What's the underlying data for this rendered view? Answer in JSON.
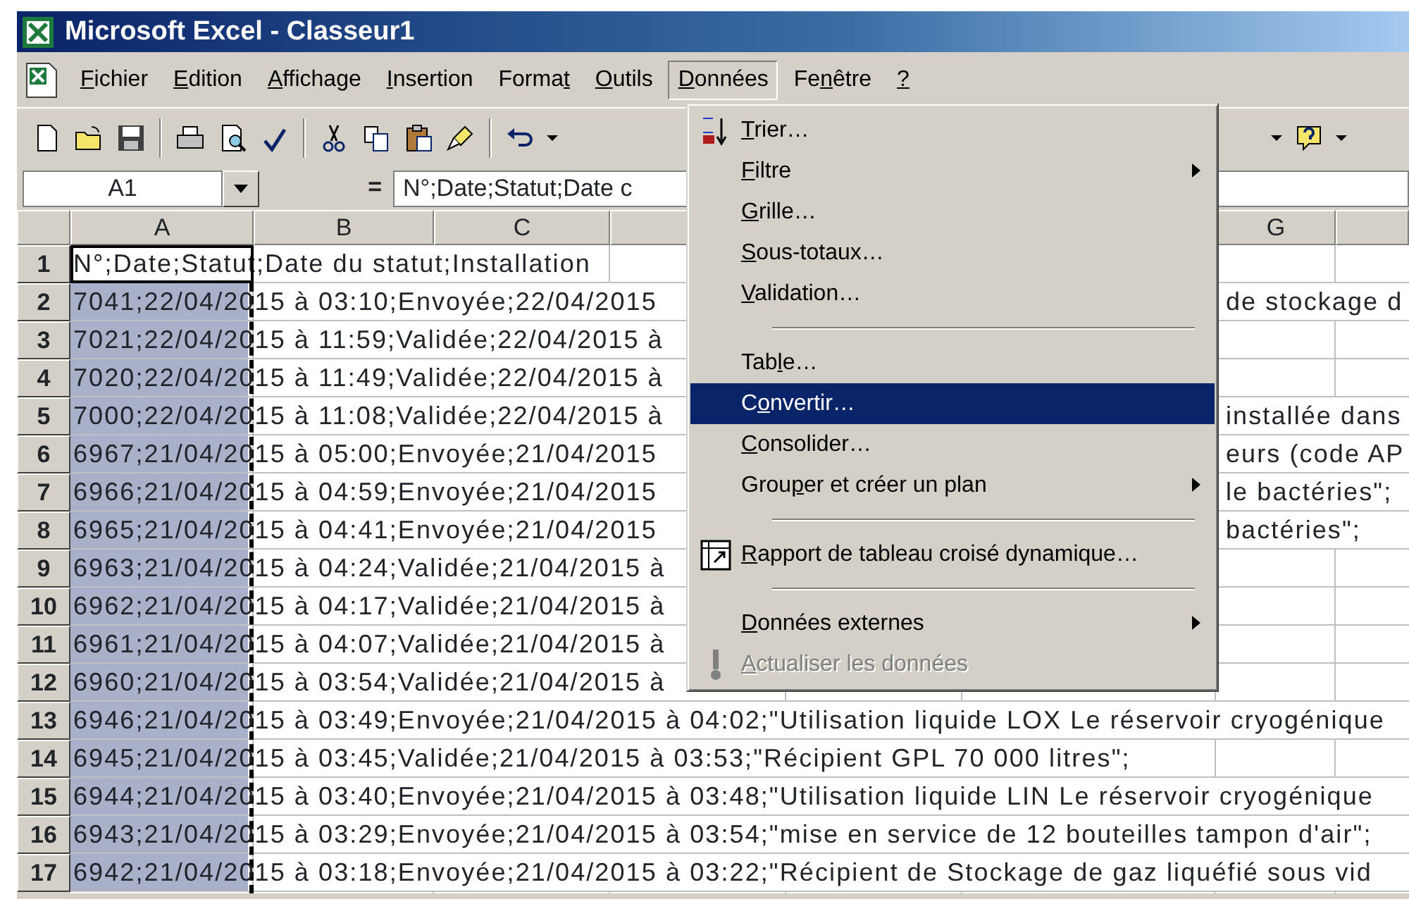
{
  "window": {
    "title": "Microsoft Excel - Classeur1"
  },
  "menubar": [
    {
      "key": "F",
      "after": "ichier",
      "selected": false
    },
    {
      "key": "E",
      "after": "dition",
      "selected": false
    },
    {
      "key": "A",
      "after": "ffichage",
      "selected": false
    },
    {
      "key": "I",
      "after": "nsertion",
      "selected": false
    },
    {
      "before": "Forma",
      "key": "t",
      "selected": false
    },
    {
      "key": "O",
      "after": "utils",
      "selected": false
    },
    {
      "key": "D",
      "after": "onnées",
      "selected": true
    },
    {
      "before": "Fe",
      "key": "n",
      "after": "être",
      "selected": false
    },
    {
      "key": "?",
      "selected": false
    }
  ],
  "toolbar": [
    {
      "kind": "new"
    },
    {
      "kind": "open"
    },
    {
      "kind": "save"
    },
    {
      "kind": "separator"
    },
    {
      "kind": "print"
    },
    {
      "kind": "preview"
    },
    {
      "kind": "spelling"
    },
    {
      "kind": "separator"
    },
    {
      "kind": "cut"
    },
    {
      "kind": "copy"
    },
    {
      "kind": "paste"
    },
    {
      "kind": "painter"
    },
    {
      "kind": "separator"
    },
    {
      "kind": "undo"
    },
    {
      "kind": "dropdown"
    }
  ],
  "toolbar_right": [
    {
      "kind": "dropdown"
    },
    {
      "kind": "help"
    },
    {
      "kind": "dropdown"
    }
  ],
  "formula_bar": {
    "name_box": "A1",
    "equals": "=",
    "value": "N°;Date;Statut;Date c"
  },
  "columns": [
    {
      "label": "A"
    },
    {
      "label": "B"
    },
    {
      "label": "C"
    },
    {},
    {
      "label": "G"
    },
    {}
  ],
  "rows": [
    {
      "header": "1",
      "text": "N°;Date;Statut;Date du statut;Installation",
      "selected": false,
      "active": true
    },
    {
      "header": "2",
      "text": "7041;22/04/2015 à 03:10;Envoyée;22/04/2015",
      "right_text": "de stockage d",
      "selected": true,
      "active": false
    },
    {
      "header": "3",
      "text": "7021;22/04/2015 à 11:59;Validée;22/04/2015 à",
      "selected": true,
      "active": false
    },
    {
      "header": "4",
      "text": "7020;22/04/2015 à 11:49;Validée;22/04/2015 à",
      "selected": true,
      "active": false
    },
    {
      "header": "5",
      "text": "7000;22/04/2015 à 11:08;Validée;22/04/2015 à",
      "right_text": "installée dans",
      "selected": true,
      "active": false
    },
    {
      "header": "6",
      "text": "6967;21/04/2015 à 05:00;Envoyée;21/04/2015",
      "right_text": "eurs (code AP",
      "selected": true,
      "active": false
    },
    {
      "header": "7",
      "text": "6966;21/04/2015 à 04:59;Envoyée;21/04/2015",
      "right_text": "le bactéries\";",
      "selected": true,
      "active": false
    },
    {
      "header": "8",
      "text": "6965;21/04/2015 à 04:41;Envoyée;21/04/2015",
      "right_text": "bactéries\";",
      "selected": true,
      "active": false
    },
    {
      "header": "9",
      "text": "6963;21/04/2015 à 04:24;Validée;21/04/2015 à",
      "selected": true,
      "active": false
    },
    {
      "header": "10",
      "text": "6962;21/04/2015 à 04:17;Validée;21/04/2015 à",
      "selected": true,
      "active": false
    },
    {
      "header": "11",
      "text": "6961;21/04/2015 à 04:07;Validée;21/04/2015 à",
      "selected": true,
      "active": false
    },
    {
      "header": "12",
      "text": "6960;21/04/2015 à 03:54;Validée;21/04/2015 à",
      "selected": true,
      "active": false
    },
    {
      "header": "13",
      "text": "6946;21/04/2015 à 03:49;Envoyée;21/04/2015 à 04:02;\"Utilisation liquide LOX Le réservoir cryogénique",
      "selected": true,
      "active": false
    },
    {
      "header": "14",
      "text": "6945;21/04/2015 à 03:45;Validée;21/04/2015 à 03:53;\"Récipient GPL 70 000 litres\";",
      "selected": true,
      "active": false
    },
    {
      "header": "15",
      "text": "6944;21/04/2015 à 03:40;Envoyée;21/04/2015 à 03:48;\"Utilisation liquide LIN Le réservoir cryogénique",
      "selected": true,
      "active": false
    },
    {
      "header": "16",
      "text": "6943;21/04/2015 à 03:29;Envoyée;21/04/2015 à 03:54;\"mise en service de 12 bouteilles tampon d'air\";",
      "selected": true,
      "active": false
    },
    {
      "header": "17",
      "text": "6942;21/04/2015 à 03:18;Envoyée;21/04/2015 à 03:22;\"Récipient de Stockage de gaz liquéfié sous vid",
      "selected": true,
      "active": false
    }
  ],
  "data_menu": [
    {
      "kind": "item",
      "key": "T",
      "after": "rier…",
      "submenu": false,
      "selected": false,
      "disabled": false
    },
    {
      "kind": "item",
      "key": "F",
      "after": "iltre",
      "submenu": true,
      "selected": false,
      "disabled": false
    },
    {
      "kind": "item",
      "key": "G",
      "after": "rille…",
      "submenu": false,
      "selected": false,
      "disabled": false
    },
    {
      "kind": "item",
      "key": "S",
      "after": "ous-totaux…",
      "submenu": false,
      "selected": false,
      "disabled": false
    },
    {
      "kind": "item",
      "key": "V",
      "after": "alidation…",
      "submenu": false,
      "selected": false,
      "disabled": false
    },
    {
      "kind": "separator"
    },
    {
      "kind": "item",
      "before": "Tab",
      "key": "l",
      "after": "e…",
      "submenu": false,
      "selected": false,
      "disabled": false
    },
    {
      "kind": "item",
      "before": "C",
      "key": "o",
      "after": "nvertir…",
      "submenu": false,
      "selected": true,
      "disabled": false
    },
    {
      "kind": "item",
      "key": "C",
      "after": "onsolider…",
      "submenu": false,
      "selected": false,
      "disabled": false
    },
    {
      "kind": "item",
      "before": "Grou",
      "key": "p",
      "after": "er et créer un plan",
      "submenu": true,
      "selected": false,
      "disabled": false
    },
    {
      "kind": "separator"
    },
    {
      "kind": "item",
      "key": "R",
      "after": "apport de tableau croisé dynamique…",
      "submenu": false,
      "selected": false,
      "disabled": false
    },
    {
      "kind": "separator"
    },
    {
      "kind": "item",
      "key": "D",
      "after": "onnées externes",
      "submenu": true,
      "selected": false,
      "disabled": false
    },
    {
      "kind": "item",
      "key": "A",
      "after": "ctualiser les données",
      "submenu": false,
      "selected": false,
      "disabled": true
    }
  ]
}
